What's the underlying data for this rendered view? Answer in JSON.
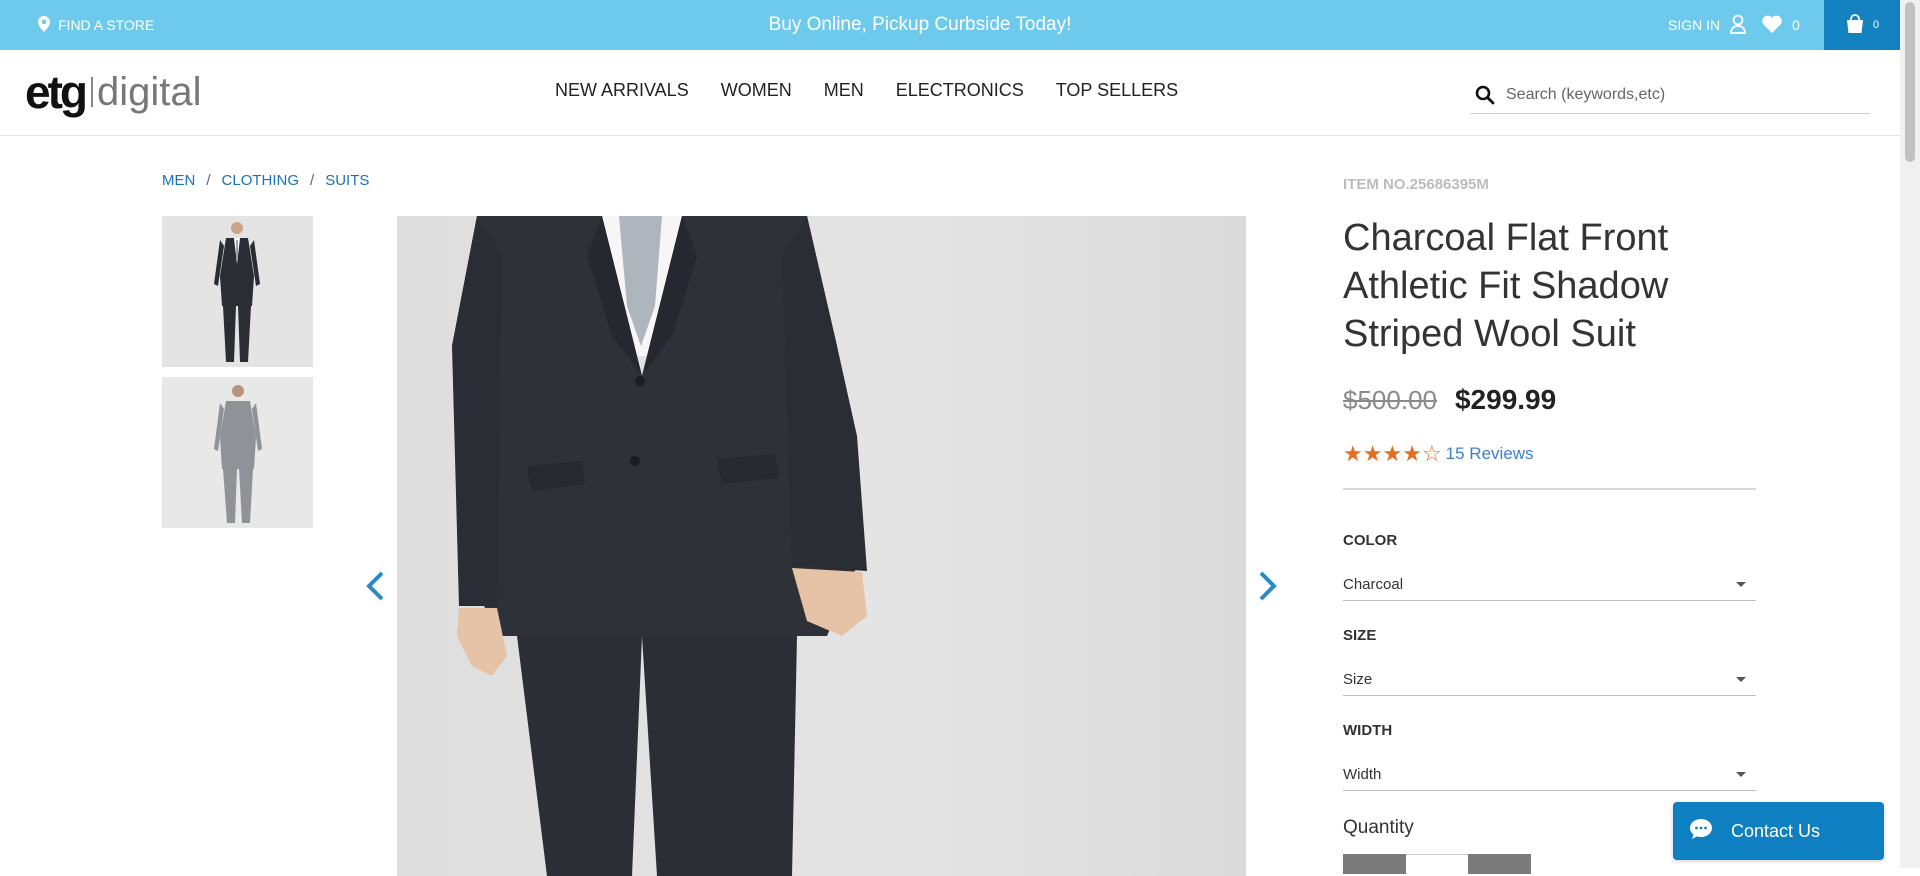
{
  "topbar": {
    "find_store": "FIND A STORE",
    "promo": "Buy Online, Pickup Curbside Today!",
    "sign_in": "SIGN IN",
    "wishlist_count": "0",
    "cart_count": "0"
  },
  "header": {
    "logo_etg": "etg",
    "logo_digital": "digital",
    "nav": [
      "NEW ARRIVALS",
      "WOMEN",
      "MEN",
      "ELECTRONICS",
      "TOP SELLERS"
    ],
    "search_placeholder": "Search (keywords,etc)"
  },
  "breadcrumb": [
    "MEN",
    "CLOTHING",
    "SUITS"
  ],
  "product": {
    "item_no": "ITEM NO.25686395M",
    "title": "Charcoal Flat Front Athletic Fit Shadow Striped Wool Suit",
    "old_price": "$500.00",
    "price": "$299.99",
    "rating": 4,
    "rating_max": 5,
    "reviews": "15 Reviews",
    "options": {
      "color_label": "COLOR",
      "color_value": "Charcoal",
      "size_label": "SIZE",
      "size_value": "Size",
      "width_label": "WIDTH",
      "width_value": "Width"
    },
    "quantity_label": "Quantity"
  },
  "contact": {
    "label": "Contact Us"
  },
  "colors": {
    "topbar": "#6ecaec",
    "cart_bg": "#1481c0",
    "link": "#1a73b8",
    "star": "#e56e21",
    "contact_bg": "#0e7fc0"
  },
  "icons": [
    "map-pin-icon",
    "user-icon",
    "heart-icon",
    "shopping-bag-icon",
    "search-icon",
    "chevron-left-icon",
    "chevron-right-icon",
    "chat-icon"
  ]
}
